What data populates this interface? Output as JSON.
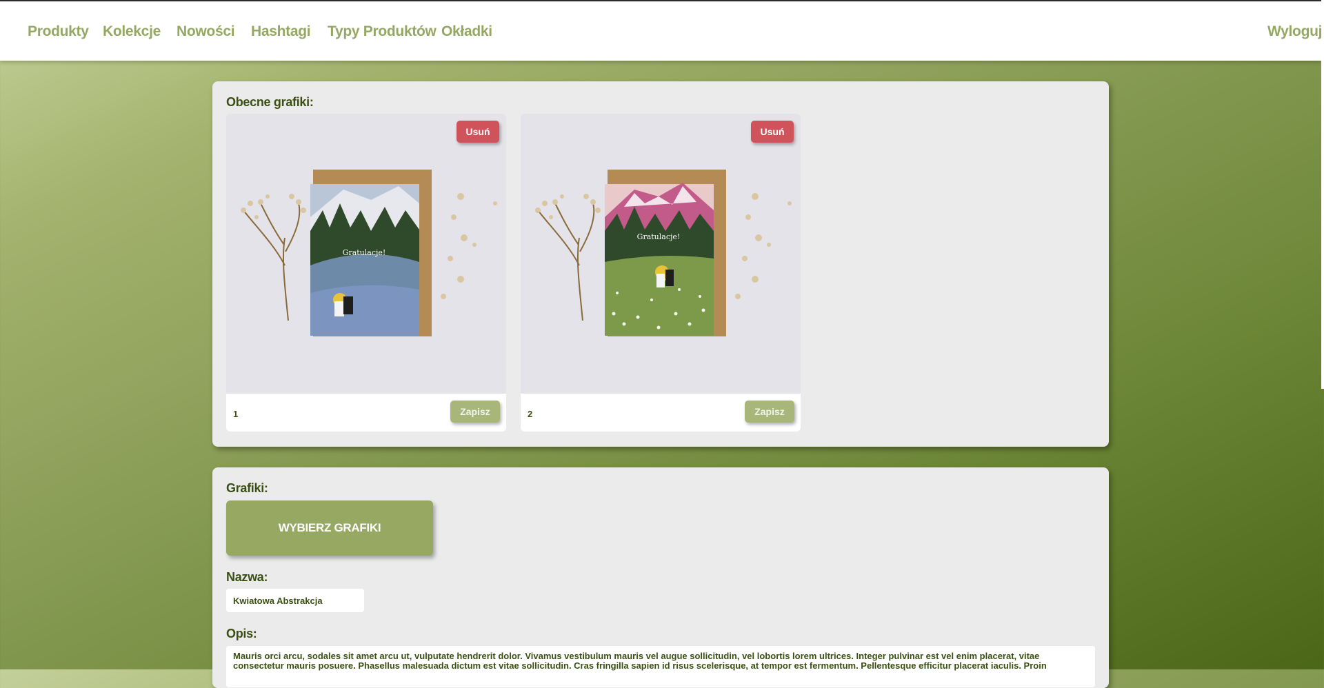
{
  "nav": {
    "items": [
      "Produkty",
      "Kolekcje",
      "Nowości",
      "Hashtagi",
      "Typy Produktów",
      "Okładki"
    ],
    "logout": "Wyloguj"
  },
  "current_graphics": {
    "label": "Obecne grafiki:",
    "cards": [
      {
        "number": "1",
        "delete_label": "Usuń",
        "save_label": "Zapisz",
        "image_text": "Gratulacje!"
      },
      {
        "number": "2",
        "delete_label": "Usuń",
        "save_label": "Zapisz",
        "image_text": "Gratulacje!"
      }
    ]
  },
  "form": {
    "graphics_label": "Grafiki:",
    "choose_button": "WYBIERZ GRAFIKI",
    "name_label": "Nazwa:",
    "name_value": "Kwiatowa Abstrakcja",
    "description_label": "Opis:",
    "description_value": "Mauris orci arcu, sodales sit amet arcu ut, vulputate hendrerit dolor. Vivamus vestibulum mauris vel augue sollicitudin, vel lobortis lorem ultrices. Integer pulvinar est vel enim placerat, vitae consectetur mauris posuere. Phasellus malesuada dictum est vitae sollicitudin. Cras fringilla sapien id risus scelerisque, at tempor est fermentum. Pellentesque efficitur placerat iaculis. Proin"
  },
  "colors": {
    "accent": "#95a862",
    "danger": "#d0525a",
    "text_dark": "#3a4f12"
  }
}
